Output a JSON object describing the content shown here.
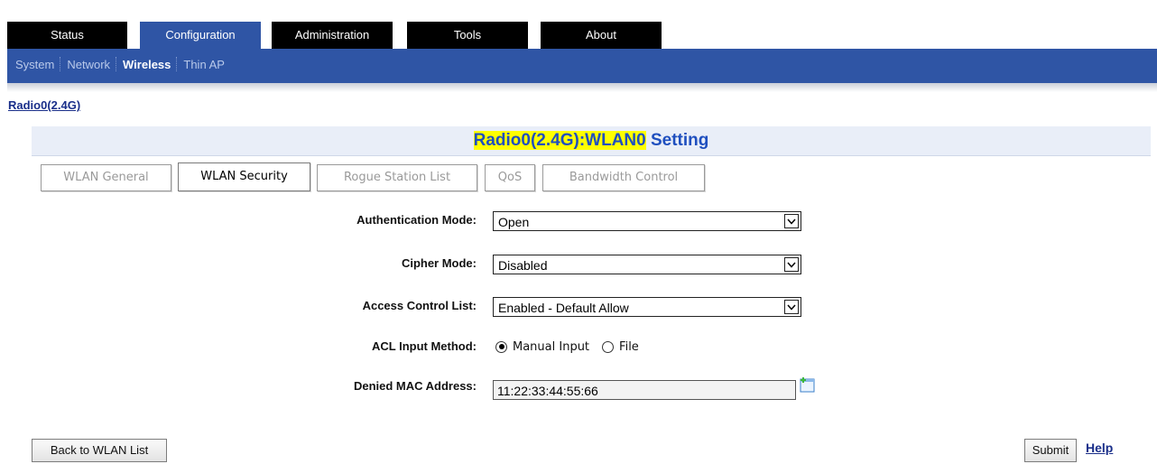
{
  "top_tabs": [
    "Status",
    "Configuration",
    "Administration",
    "Tools",
    "About"
  ],
  "active_top_tab": "Configuration",
  "sub_nav": [
    "System",
    "Network",
    "Wireless",
    "Thin AP"
  ],
  "active_sub_nav": "Wireless",
  "radio_link": "Radio0(2.4G)",
  "title": {
    "highlight": "Radio0(2.4G):WLAN0",
    "rest": " Setting"
  },
  "sub_tabs": [
    "WLAN General",
    "WLAN Security",
    "Rogue Station List",
    "QoS",
    "Bandwidth Control"
  ],
  "active_sub_tab": "WLAN Security",
  "form": {
    "auth_mode": {
      "label": "Authentication Mode:",
      "value": "Open"
    },
    "cipher_mode": {
      "label": "Cipher Mode:",
      "value": "Disabled"
    },
    "acl": {
      "label": "Access Control List:",
      "value": "Enabled - Default Allow"
    },
    "acl_method": {
      "label": "ACL Input Method:",
      "options": [
        "Manual Input",
        "File"
      ],
      "selected": "Manual Input"
    },
    "denied_mac": {
      "label": "Denied MAC Address:",
      "value": "11:22:33:44:55:66"
    }
  },
  "buttons": {
    "back": "Back to WLAN List",
    "submit": "Submit",
    "help": "Help"
  },
  "colors": {
    "nav_blue": "#2f55a5",
    "title_text": "#1f4fbf",
    "highlight": "#ffff00",
    "link": "#1a2f8a"
  },
  "icons": {
    "select_arrow": "chevron-down-icon",
    "add_mac": "add-entry-icon"
  }
}
